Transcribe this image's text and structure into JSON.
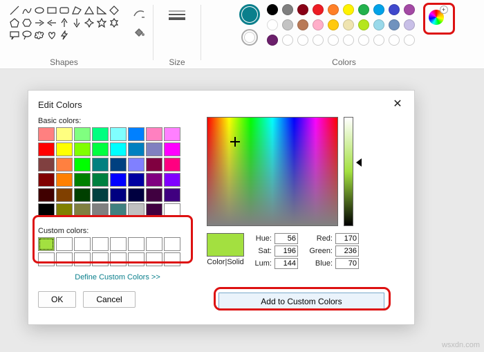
{
  "ribbon": {
    "shapes_label": "Shapes",
    "size_label": "Size",
    "colors_label": "Colors",
    "palette_row1": [
      "#000000",
      "#7f7f7f",
      "#880015",
      "#ed1c24",
      "#ff7f27",
      "#fff200",
      "#22b14c",
      "#00a2e8",
      "#3f48cc",
      "#a349a4"
    ],
    "palette_row2": [
      "#ffffff",
      "#c3c3c3",
      "#b97a57",
      "#ffaec9",
      "#ffc90e",
      "#efe4b0",
      "#b5e61d",
      "#99d9ea",
      "#7092be",
      "#c8bfe7"
    ],
    "palette_row3_empty_count": 10,
    "extra_swatch": "#6b1f6b"
  },
  "dialog": {
    "title": "Edit Colors",
    "basic_label": "Basic colors:",
    "custom_label": "Custom colors:",
    "define_link": "Define Custom Colors >>",
    "ok": "OK",
    "cancel": "Cancel",
    "add": "Add to Custom Colors",
    "color_solid": "Color|Solid",
    "basic_colors": [
      "#ff8080",
      "#ffff80",
      "#80ff80",
      "#00ff80",
      "#80ffff",
      "#0080ff",
      "#ff80c0",
      "#ff80ff",
      "#ff0000",
      "#ffff00",
      "#80ff00",
      "#00ff40",
      "#00ffff",
      "#0080c0",
      "#8080c0",
      "#ff00ff",
      "#804040",
      "#ff8040",
      "#00ff00",
      "#008080",
      "#004080",
      "#8080ff",
      "#800040",
      "#ff0080",
      "#800000",
      "#ff8000",
      "#008000",
      "#008040",
      "#0000ff",
      "#0000a0",
      "#800080",
      "#8000ff",
      "#400000",
      "#804000",
      "#004000",
      "#004040",
      "#000080",
      "#000040",
      "#400040",
      "#400080",
      "#000000",
      "#808000",
      "#808040",
      "#808080",
      "#408080",
      "#c0c0c0",
      "#400040",
      "#ffffff"
    ],
    "hue_label": "Hue:",
    "hue": "56",
    "sat_label": "Sat:",
    "sat": "196",
    "lum_label": "Lum:",
    "lum": "144",
    "red_label": "Red:",
    "red": "170",
    "green_label": "Green:",
    "green": "236",
    "blue_label": "Blue:",
    "blue": "70",
    "preview_color": "#a3e040"
  },
  "watermark": "wsxdn.com"
}
